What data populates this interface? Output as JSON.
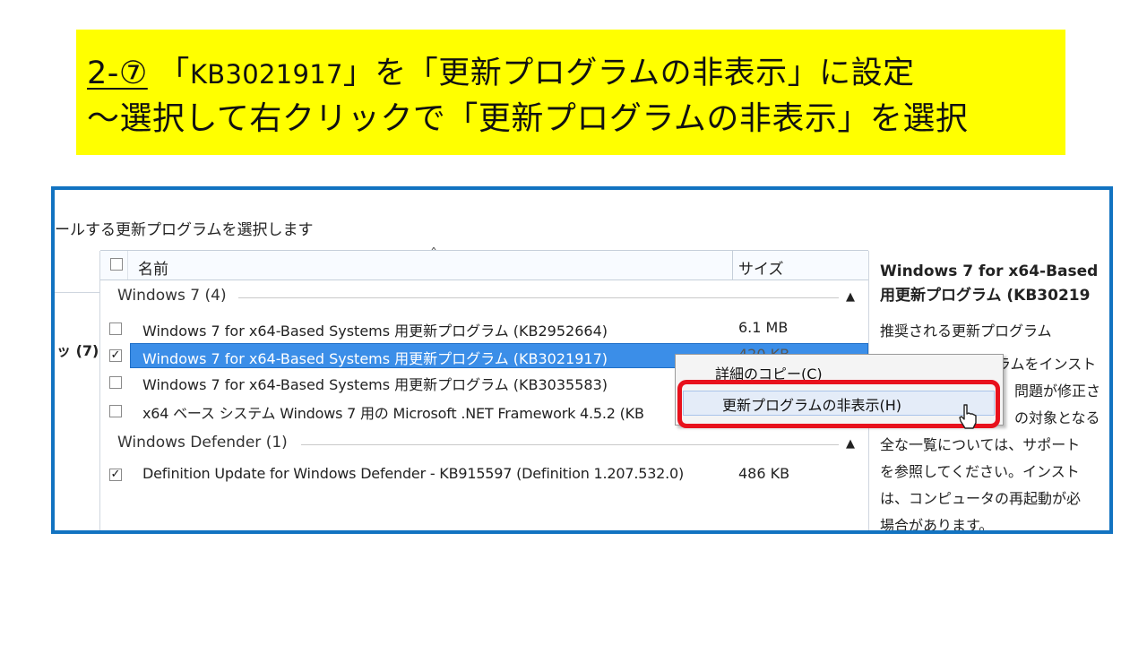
{
  "banner": {
    "step": "2-⑦",
    "line1_open": "「",
    "kb_code": "KB3021917",
    "line1_rest": "」を「更新プログラムの非表示」に設定",
    "line2": "～選択して右クリックで「更新プログラムの非表示」を選択",
    "background": "#ffff00"
  },
  "window": {
    "heading": "ールする更新プログラムを選択します",
    "left_count": "ッ (7)",
    "columns": {
      "name": "名前",
      "size": "サイズ"
    },
    "groups": [
      {
        "label": "Windows 7 (4)",
        "items": [
          {
            "name": "Windows 7 for x64-Based Systems 用更新プログラム (KB2952664)",
            "size": "6.1 MB",
            "checked": false
          },
          {
            "name": "Windows 7 for x64-Based Systems 用更新プログラム (KB3021917)",
            "size": "420 KB",
            "checked": true,
            "selected": true
          },
          {
            "name": "Windows 7 for x64-Based Systems 用更新プログラム (KB3035583)",
            "size": "",
            "checked": false
          },
          {
            "name": "x64 ベース システム Windows 7 用の Microsoft .NET Framework 4.5.2 (KB",
            "size": "",
            "checked": false
          }
        ]
      },
      {
        "label": "Windows Defender (1)",
        "items": [
          {
            "name": "Definition Update for Windows Defender - KB915597 (Definition 1.207.532.0)",
            "size": "486 KB",
            "checked": true
          }
        ]
      }
    ],
    "detail": {
      "title_line1": "Windows 7 for x64-Based",
      "title_line2": "用更新プログラム (KB30219",
      "type": "推奨される更新プログラム",
      "lines": [
        "ラムをインスト",
        "問題が修正さ",
        "の対象となる",
        "全な一覧については、サポート",
        "を参照してください。インスト",
        "は、コンピュータの再起動が必",
        "場合があります。"
      ]
    },
    "context_menu": {
      "items": [
        "詳細のコピー(C)",
        "更新プログラムの非表示(H)"
      ]
    },
    "frame_color": "#1273c1",
    "highlight_color": "#e8111c",
    "selection_color": "#3b8ee8"
  }
}
